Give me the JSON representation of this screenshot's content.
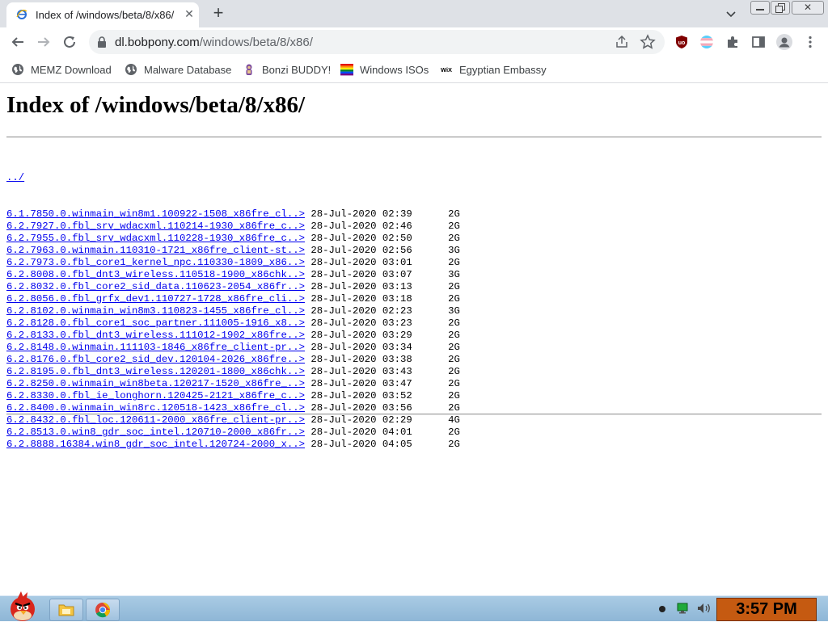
{
  "tab": {
    "title": "Index of /windows/beta/8/x86/",
    "favicon": "ie-icon"
  },
  "toolbar": {
    "url_host": "dl.bobpony.com",
    "url_path": "/windows/beta/8/x86/"
  },
  "bookmarks": [
    {
      "label": "MEMZ Download",
      "icon": "globe-icon"
    },
    {
      "label": "Malware Database",
      "icon": "globe-icon"
    },
    {
      "label": "Bonzi BUDDY!",
      "icon": "bonzi-icon"
    },
    {
      "label": "Windows ISOs",
      "icon": "windows-flag-icon"
    },
    {
      "label": "Egyptian Embassy",
      "icon": "wix-icon"
    }
  ],
  "page": {
    "heading": "Index of /windows/beta/8/x86/",
    "parent_link": "../",
    "files": [
      {
        "name": "6.1.7850.0.winmain_win8m1.100922-1508_x86fre_cl..>",
        "date": "28-Jul-2020 02:39",
        "size": "2G"
      },
      {
        "name": "6.2.7927.0.fbl_srv_wdacxml.110214-1930_x86fre_c..>",
        "date": "28-Jul-2020 02:46",
        "size": "2G"
      },
      {
        "name": "6.2.7955.0.fbl_srv_wdacxml.110228-1930_x86fre_c..>",
        "date": "28-Jul-2020 02:50",
        "size": "2G"
      },
      {
        "name": "6.2.7963.0.winmain.110310-1721_x86fre_client-st..>",
        "date": "28-Jul-2020 02:56",
        "size": "3G"
      },
      {
        "name": "6.2.7973.0.fbl_core1_kernel_npc.110330-1809_x86..>",
        "date": "28-Jul-2020 03:01",
        "size": "2G"
      },
      {
        "name": "6.2.8008.0.fbl_dnt3_wireless.110518-1900_x86chk..>",
        "date": "28-Jul-2020 03:07",
        "size": "3G"
      },
      {
        "name": "6.2.8032.0.fbl_core2_sid_data.110623-2054_x86fr..>",
        "date": "28-Jul-2020 03:13",
        "size": "2G"
      },
      {
        "name": "6.2.8056.0.fbl_grfx_dev1.110727-1728_x86fre_cli..>",
        "date": "28-Jul-2020 03:18",
        "size": "2G"
      },
      {
        "name": "6.2.8102.0.winmain_win8m3.110823-1455_x86fre_cl..>",
        "date": "28-Jul-2020 02:23",
        "size": "3G"
      },
      {
        "name": "6.2.8128.0.fbl_core1_soc_partner.111005-1916_x8..>",
        "date": "28-Jul-2020 03:23",
        "size": "2G"
      },
      {
        "name": "6.2.8133.0.fbl_dnt3_wireless.111012-1902_x86fre..>",
        "date": "28-Jul-2020 03:29",
        "size": "2G"
      },
      {
        "name": "6.2.8148.0.winmain.111103-1846_x86fre_client-pr..>",
        "date": "28-Jul-2020 03:34",
        "size": "2G"
      },
      {
        "name": "6.2.8176.0.fbl_core2_sid_dev.120104-2026_x86fre..>",
        "date": "28-Jul-2020 03:38",
        "size": "2G"
      },
      {
        "name": "6.2.8195.0.fbl_dnt3_wireless.120201-1800_x86chk..>",
        "date": "28-Jul-2020 03:43",
        "size": "2G"
      },
      {
        "name": "6.2.8250.0.winmain_win8beta.120217-1520_x86fre_..>",
        "date": "28-Jul-2020 03:47",
        "size": "2G"
      },
      {
        "name": "6.2.8330.0.fbl_ie_longhorn.120425-2121_x86fre_c..>",
        "date": "28-Jul-2020 03:52",
        "size": "2G"
      },
      {
        "name": "6.2.8400.0.winmain_win8rc.120518-1423_x86fre_cl..>",
        "date": "28-Jul-2020 03:56",
        "size": "2G"
      },
      {
        "name": "6.2.8432.0.fbl_loc.120611-2000_x86fre_client-pr..>",
        "date": "28-Jul-2020 02:29",
        "size": "4G"
      },
      {
        "name": "6.2.8513.0.win8_gdr_soc_intel.120710-2000_x86fr..>",
        "date": "28-Jul-2020 04:01",
        "size": "2G"
      },
      {
        "name": "6.2.8888.16384.win8_gdr_soc_intel.120724-2000_x..>",
        "date": "28-Jul-2020 04:05",
        "size": "2G"
      }
    ]
  },
  "taskbar": {
    "clock": "3:57 PM"
  },
  "colors": {
    "link": "#0000ee",
    "tabstrip": "#dee1e6",
    "omnibox": "#f1f3f4",
    "clock_bg": "#c55a11"
  }
}
